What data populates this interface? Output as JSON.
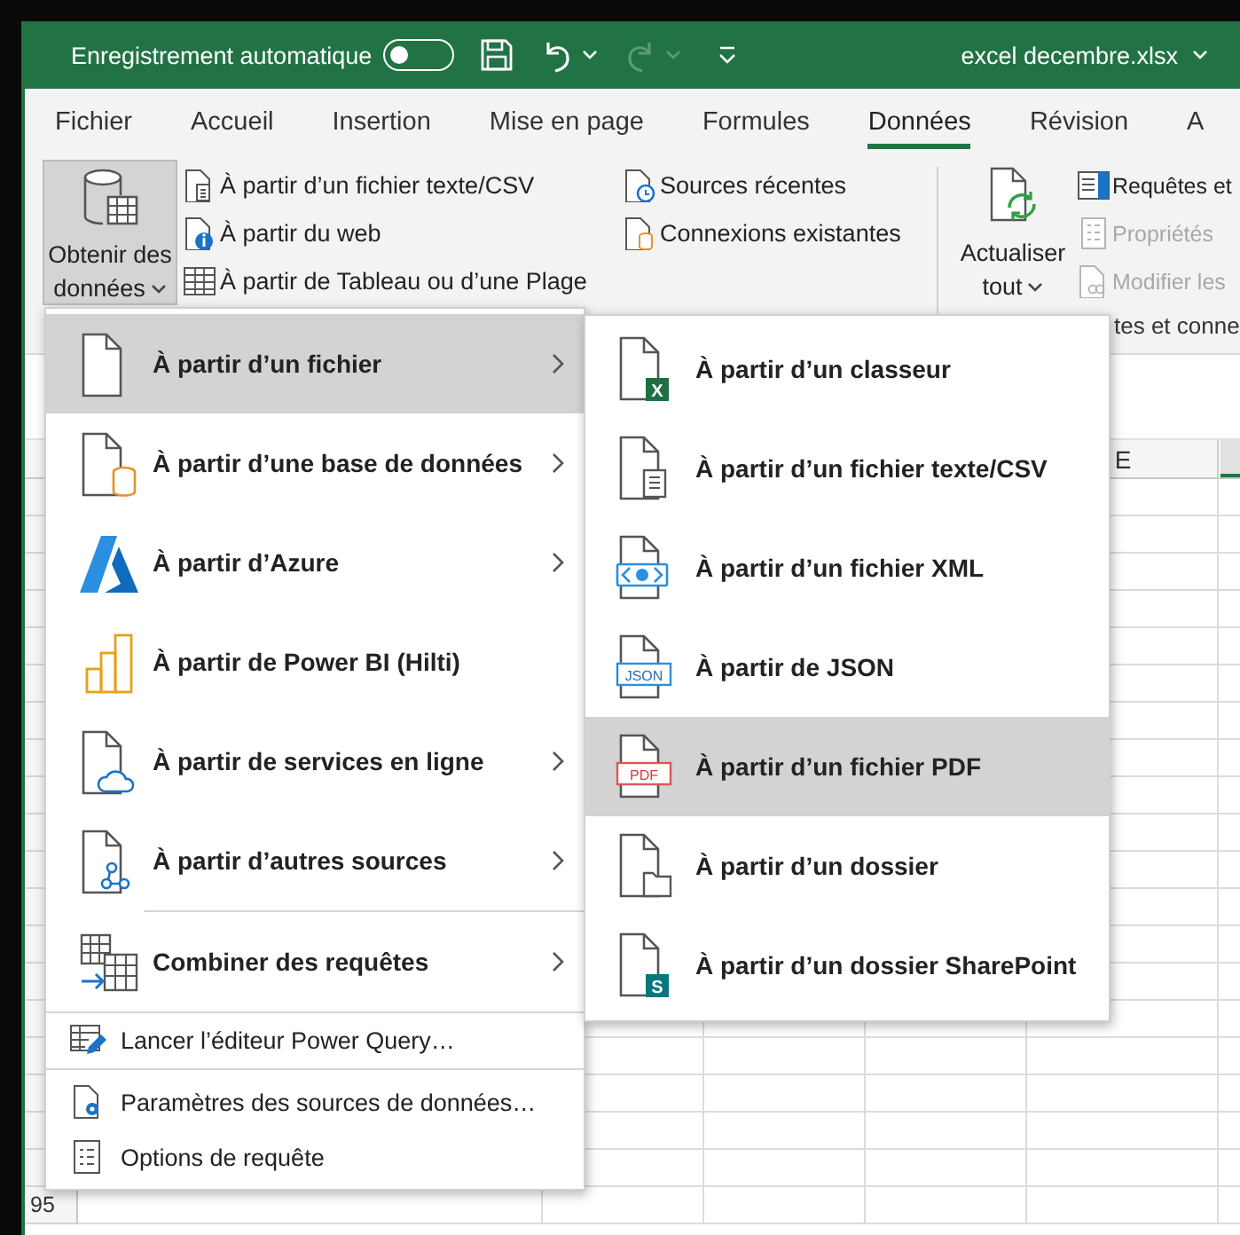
{
  "title_bar": {
    "autosave_label": "Enregistrement automatique",
    "autosave_on": false,
    "redo_disabled": true,
    "file_name": "excel decembre.xlsx"
  },
  "tabs": [
    {
      "label": "Fichier",
      "selected": false
    },
    {
      "label": "Accueil",
      "selected": false
    },
    {
      "label": "Insertion",
      "selected": false
    },
    {
      "label": "Mise en page",
      "selected": false
    },
    {
      "label": "Formules",
      "selected": false
    },
    {
      "label": "Données",
      "selected": true
    },
    {
      "label": "Révision",
      "selected": false
    },
    {
      "label": "A",
      "selected": false
    }
  ],
  "ribbon": {
    "get_data": {
      "label_lines": [
        "Obtenir des",
        "données"
      ],
      "pressed": true
    },
    "import_items": [
      {
        "label": "À partir d’un fichier texte/CSV"
      },
      {
        "label": "À partir du web"
      },
      {
        "label": "À partir de Tableau ou d’une Plage"
      }
    ],
    "connection_items": [
      {
        "label": "Sources récentes"
      },
      {
        "label": "Connexions existantes"
      }
    ],
    "refresh": {
      "label_lines": [
        "Actualiser",
        "tout"
      ]
    },
    "query_items": [
      {
        "label": "Requêtes et",
        "disabled": false
      },
      {
        "label": "Propriétés",
        "disabled": true
      },
      {
        "label": "Modifier les",
        "disabled": true
      }
    ],
    "group_label": "tes et conne"
  },
  "sheet": {
    "column_header": "E",
    "row_header": "95"
  },
  "menu": {
    "source_items": [
      {
        "label": "À partir d’un fichier",
        "submenu": true,
        "selected": true
      },
      {
        "label": "À partir d’une base de données",
        "submenu": true,
        "selected": false
      },
      {
        "label": "À partir d’Azure",
        "submenu": true,
        "selected": false
      },
      {
        "label": "À partir de Power BI (Hilti)",
        "submenu": false,
        "selected": false
      },
      {
        "label": "À partir de services en ligne",
        "submenu": true,
        "selected": false
      },
      {
        "label": "À partir d’autres sources",
        "submenu": true,
        "selected": false
      }
    ],
    "combine_items": [
      {
        "label": "Combiner des requêtes",
        "submenu": true,
        "selected": false
      }
    ],
    "commands": [
      {
        "label": "Lancer l’éditeur Power Query…"
      },
      {
        "label": "Paramètres des sources de données…"
      },
      {
        "label": "Options de requête"
      }
    ]
  },
  "submenu": {
    "items": [
      {
        "label": "À partir d’un classeur",
        "selected": false,
        "icon_label": "X"
      },
      {
        "label": "À partir d’un fichier texte/CSV",
        "selected": false
      },
      {
        "label": "À partir d’un fichier XML",
        "selected": false
      },
      {
        "label": "À partir de JSON",
        "selected": false,
        "icon_label": "JSON"
      },
      {
        "label": "À partir d’un fichier PDF",
        "selected": true,
        "icon_label": "PDF"
      },
      {
        "label": "À partir d’un dossier",
        "selected": false
      },
      {
        "label": "À partir d’un dossier SharePoint",
        "selected": false,
        "icon_label": "S"
      }
    ]
  }
}
